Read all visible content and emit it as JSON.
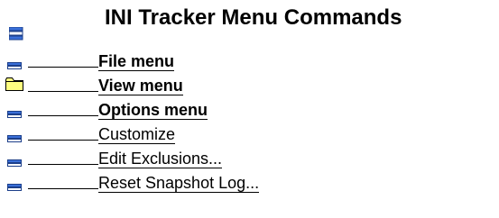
{
  "title": "INI Tracker Menu Commands",
  "items": [
    {
      "label": "File menu",
      "icon": "book-icon",
      "bold": true
    },
    {
      "label": "View menu",
      "icon": "folder-icon",
      "bold": true
    },
    {
      "label": "Options menu",
      "icon": "book-icon",
      "bold": true
    },
    {
      "label": "Customize",
      "icon": "book-icon",
      "bold": false
    },
    {
      "label": "Edit Exclusions...",
      "icon": "book-icon",
      "bold": false
    },
    {
      "label": "Reset Snapshot Log...",
      "icon": "book-icon",
      "bold": false
    }
  ],
  "colors": {
    "book_blue": "#3a6fd8",
    "book_dark": "#1c3f8a",
    "folder_yellow": "#ffff80",
    "text": "#000000"
  }
}
